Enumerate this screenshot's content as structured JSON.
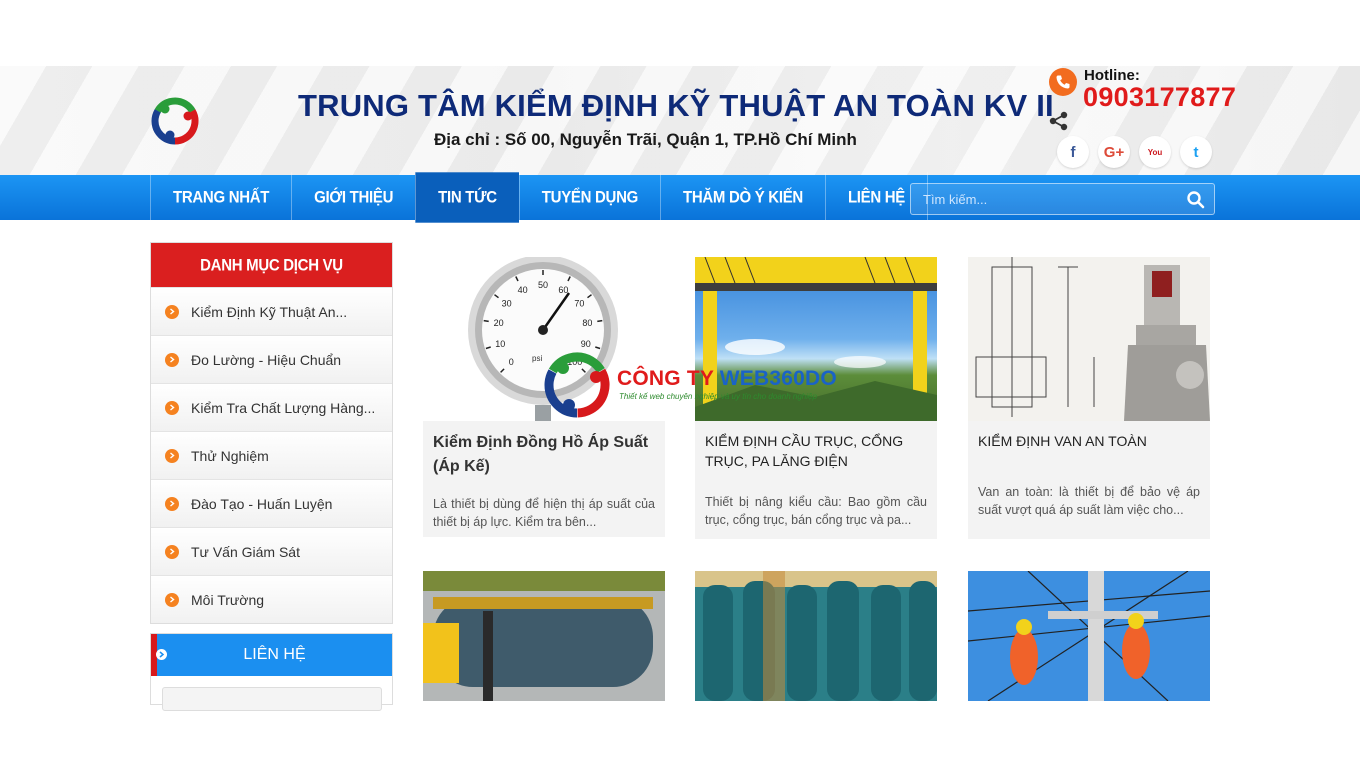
{
  "header": {
    "title": "TRUNG TÂM KIỂM ĐỊNH KỸ THUẬT AN TOÀN KV II",
    "address": "Địa chỉ : Số 00, Nguyễn Trãi, Quận 1, TP.Hồ Chí Minh",
    "hotline_label": "Hotline:",
    "hotline_number": "0903177877",
    "socials": [
      {
        "name": "facebook",
        "glyph": "f",
        "color": "#3b5998"
      },
      {
        "name": "google-plus",
        "glyph": "G+",
        "color": "#dd4b39"
      },
      {
        "name": "youtube",
        "glyph": "You",
        "color": "#cc181e"
      },
      {
        "name": "twitter",
        "glyph": "t",
        "color": "#1da1f2"
      }
    ]
  },
  "nav": {
    "items": [
      "TRANG NHẤT",
      "GIỚI THIỆU",
      "TIN TỨC",
      "TUYỂN DỤNG",
      "THĂM DÒ Ý KIẾN",
      "LIÊN HỆ"
    ],
    "active": "TIN TỨC",
    "search_placeholder": "Tìm kiếm..."
  },
  "sidebar": {
    "category_title": "DANH MỤC DỊCH VỤ",
    "categories": [
      "Kiểm Định Kỹ Thuật An...",
      "Đo Lường - Hiệu Chuẩn",
      "Kiểm Tra Chất Lượng Hàng...",
      "Thử Nghiệm",
      "Đào Tạo - Huấn Luyện",
      "Tư Vấn Giám Sát",
      "Môi Trường"
    ],
    "contact_title": "LIÊN HỆ"
  },
  "cards": [
    {
      "title": "Kiểm Định Đồng Hồ Áp Suất (Áp Kế)",
      "desc": "Là thiết bị dùng để hiện thị áp suất của thiết bị áp lực. Kiểm tra bên..."
    },
    {
      "title": "KIỂM ĐỊNH CẦU TRỤC, CỔNG TRỤC, PA LĂNG ĐIỆN",
      "desc": "Thiết bị nâng kiểu cầu: Bao gồm cầu trục, cổng trục, bán cổng trục và pa..."
    },
    {
      "title": "KIỂM ĐỊNH VAN AN TOÀN",
      "desc": "Van an toàn: là thiết bị để bảo vệ áp suất vượt quá áp suất làm việc cho..."
    }
  ],
  "watermark": {
    "title_red": "CÔNG TY ",
    "title_blue": "WEB360DO",
    "subtitle": "Thiết kế web chuyên nghiệp và uy tín cho doanh nghiệp"
  },
  "gauge": {
    "ticks": [
      "0",
      "10",
      "20",
      "30",
      "40",
      "50",
      "60",
      "70",
      "80",
      "90",
      "100"
    ],
    "unit": "psi"
  }
}
